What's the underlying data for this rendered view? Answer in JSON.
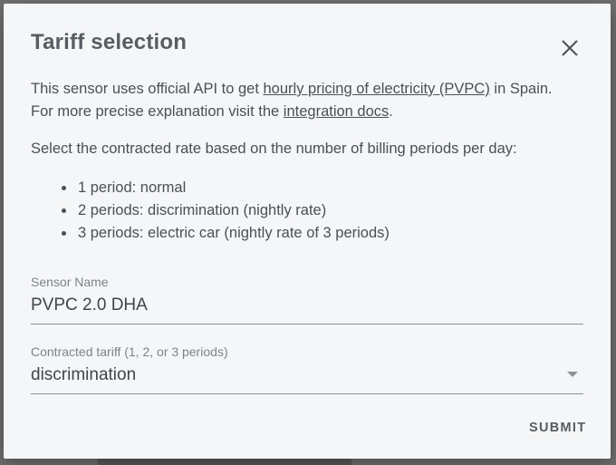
{
  "dialog": {
    "title": "Tariff selection",
    "close_icon": "close-icon",
    "intro": {
      "text_before_link1": "This sensor uses official API to get ",
      "link1": "hourly pricing of electricity (PVPC)",
      "text_after_link1": " in Spain.",
      "text_before_link2": "For more precise explanation visit the ",
      "link2": "integration docs",
      "text_after_link2": "."
    },
    "instruction": "Select the contracted rate based on the number of billing periods per day:",
    "periods": [
      "1 period: normal",
      "2 periods: discrimination (nightly rate)",
      "3 periods: electric car (nightly rate of 3 periods)"
    ],
    "sensor_name": {
      "label": "Sensor Name",
      "value": "PVPC 2.0 DHA"
    },
    "tariff": {
      "label": "Contracted tariff (1, 2, or 3 periods)",
      "selected": "discrimination",
      "arrow_icon": "dropdown-arrow-icon"
    },
    "submit_label": "SUBMIT"
  },
  "colors": {
    "dialog_bg": "#f5f6f8",
    "backdrop": "#707070",
    "title": "#575d63",
    "text": "#4a5056"
  }
}
